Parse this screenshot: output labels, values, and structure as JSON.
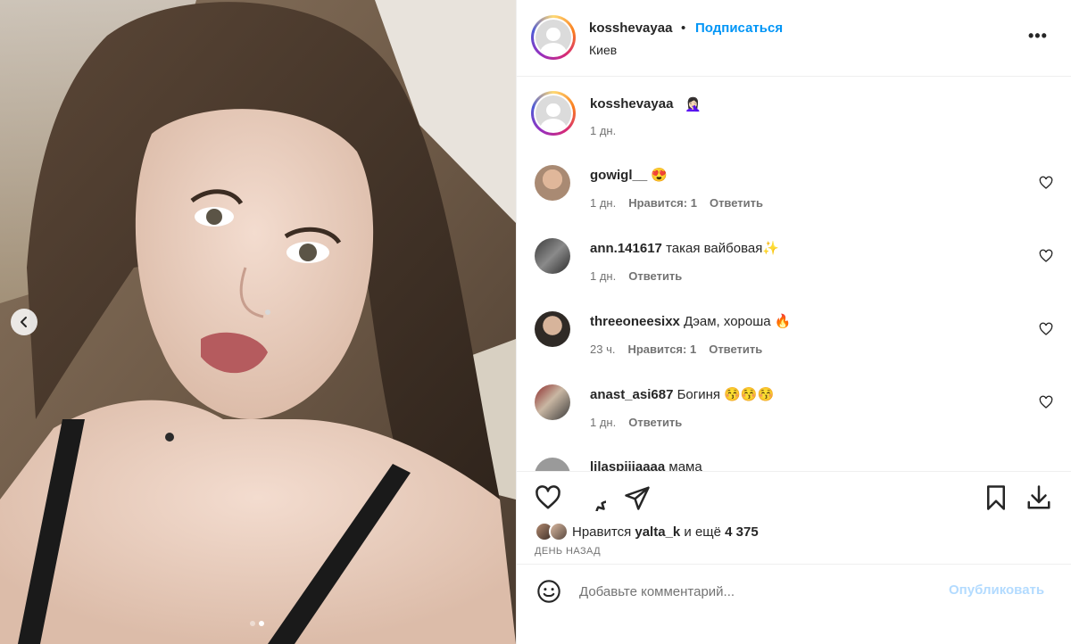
{
  "post": {
    "author": "kosshevayaa",
    "separator": "•",
    "follow_label": "Подписаться",
    "location": "Киев",
    "more_label": "•••"
  },
  "caption": {
    "author": "kosshevayaa",
    "emoji": "🤦🏻‍♀️",
    "time": "1 дн."
  },
  "comments": [
    {
      "user": "gowigl__",
      "text": "😍",
      "time": "1 дн.",
      "likes": "Нравится: 1",
      "reply": "Ответить"
    },
    {
      "user": "ann.141617",
      "text": "такая вайбовая✨",
      "time": "1 дн.",
      "likes": "",
      "reply": "Ответить"
    },
    {
      "user": "threeoneesixx",
      "text": "Дэам, хороша 🔥",
      "time": "23 ч.",
      "likes": "Нравится: 1",
      "reply": "Ответить"
    },
    {
      "user": "anast_asi687",
      "text": "Богиня 😚😚😚",
      "time": "1 дн.",
      "likes": "",
      "reply": "Ответить"
    },
    {
      "user": "lilaspiiiaaaa",
      "text": "мама",
      "time": "",
      "likes": "",
      "reply": ""
    }
  ],
  "likes_summary": {
    "prefix": "Нравится",
    "user": "yalta_k",
    "suffix": "и ещё",
    "count": "4 375"
  },
  "posted_when": "ДЕНЬ НАЗАД",
  "comment_box": {
    "placeholder": "Добавьте комментарий...",
    "publish_label": "Опубликовать"
  },
  "carousel": {
    "current": 2,
    "total": 2
  },
  "colors": {
    "accent": "#0095f6",
    "publish_disabled": "#b3dbff",
    "muted": "#737373"
  }
}
